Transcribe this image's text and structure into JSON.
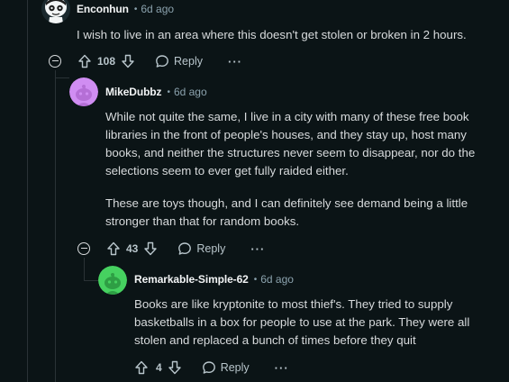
{
  "comments": [
    {
      "author": "Enconhun",
      "separator": "•",
      "timestamp": "6d ago",
      "paragraphs": [
        "I wish to live in an area where this doesn't get stolen or broken in 2 hours."
      ],
      "score": "108",
      "reply_label": "Reply",
      "more_label": "···",
      "avatar_color": "#f2f4f5"
    },
    {
      "author": "MikeDubbz",
      "separator": "•",
      "timestamp": "6d ago",
      "paragraphs": [
        "While not quite the same, I live in a city with many of these free book libraries in the front of people's houses, and they stay up, host many books, and neither the structures never seem to disappear, nor do the selections seem to ever get fully raided either.",
        "These are toys though, and I can definitely see demand being a little stronger than that for random books."
      ],
      "score": "43",
      "reply_label": "Reply",
      "more_label": "···",
      "avatar_color": "#d08df2"
    },
    {
      "author": "Remarkable-Simple-62",
      "separator": "•",
      "timestamp": "6d ago",
      "paragraphs": [
        "Books are like kryptonite to most thief's. They tried to supply basketballs in a box for people to use at the park. They were all stolen and replaced a bunch of times before they quit"
      ],
      "score": "4",
      "reply_label": "Reply",
      "more_label": "···",
      "avatar_color": "#46d160"
    }
  ],
  "colors": {
    "background": "#0b1416",
    "thread_line": "#2a3236",
    "text": "#d7dadc",
    "meta": "#8ba2ad"
  }
}
